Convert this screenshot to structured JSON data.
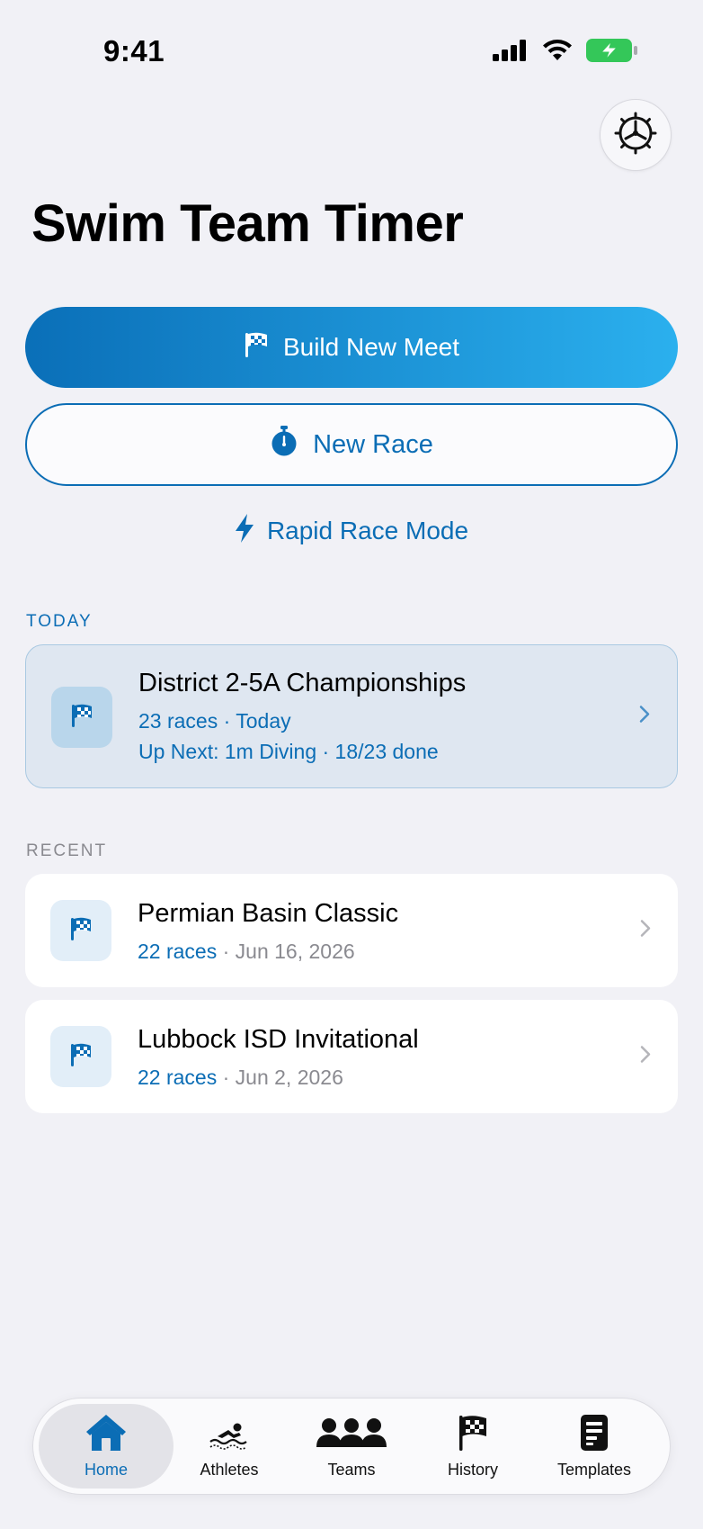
{
  "status_bar": {
    "time": "9:41"
  },
  "page": {
    "title": "Swim Team Timer"
  },
  "actions": {
    "build_meet": "Build New Meet",
    "new_race": "New Race",
    "rapid_race": "Rapid Race Mode"
  },
  "today": {
    "label": "TODAY",
    "meet": {
      "title": "District 2-5A Championships",
      "races": "23 races",
      "date": "Today",
      "up_next": "Up Next: 1m Diving · 18/23 done"
    }
  },
  "recent": {
    "label": "RECENT",
    "items": [
      {
        "title": "Permian Basin Classic",
        "races": "22 races",
        "date": "Jun 16, 2026"
      },
      {
        "title": "Lubbock ISD Invitational",
        "races": "22 races",
        "date": "Jun 2, 2026"
      }
    ]
  },
  "tabs": [
    {
      "label": "Home",
      "icon": "house-icon",
      "active": true
    },
    {
      "label": "Athletes",
      "icon": "swimmer-icon"
    },
    {
      "label": "Teams",
      "icon": "people-icon"
    },
    {
      "label": "History",
      "icon": "checkered-flag-icon"
    },
    {
      "label": "Templates",
      "icon": "document-icon"
    }
  ],
  "colors": {
    "accent": "#0b6db5",
    "gradient_start": "#0a6fb8",
    "gradient_end": "#2bb0ee",
    "battery": "#34c759"
  }
}
